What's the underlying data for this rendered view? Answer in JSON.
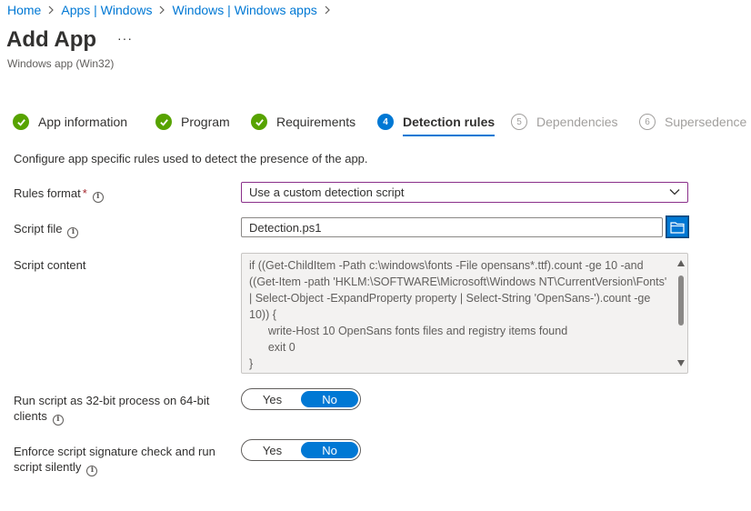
{
  "breadcrumb": [
    {
      "label": "Home"
    },
    {
      "label": "Apps | Windows"
    },
    {
      "label": "Windows | Windows apps"
    }
  ],
  "page": {
    "title": "Add App",
    "more_label": "···",
    "subtitle": "Windows app (Win32)"
  },
  "steps": [
    {
      "label": "App information",
      "state": "done",
      "icon": "checkmark-icon"
    },
    {
      "label": "Program",
      "state": "done",
      "icon": "checkmark-icon"
    },
    {
      "label": "Requirements",
      "state": "done",
      "icon": "checkmark-icon"
    },
    {
      "number": "4",
      "label": "Detection rules",
      "state": "active"
    },
    {
      "number": "5",
      "label": "Dependencies",
      "state": "pending"
    },
    {
      "number": "6",
      "label": "Supersedence",
      "state": "pending"
    }
  ],
  "description": "Configure app specific rules used to detect the presence of the app.",
  "form": {
    "rules_format": {
      "label": "Rules format",
      "required_marker": "*",
      "value": "Use a custom detection script"
    },
    "script_file": {
      "label": "Script file",
      "value": "Detection.ps1"
    },
    "script_content": {
      "label": "Script content",
      "value": "if ((Get-ChildItem -Path c:\\windows\\fonts -File opensans*.ttf).count -ge 10 -and ((Get-Item -path 'HKLM:\\SOFTWARE\\Microsoft\\Windows NT\\CurrentVersion\\Fonts' | Select-Object -ExpandProperty property | Select-String 'OpenSans-').count -ge 10)) {\n      write-Host 10 OpenSans fonts files and registry items found\n      exit 0\n}"
    },
    "run_32bit": {
      "label_line1": "Run script as 32-bit process on 64-bit",
      "label_line2": "clients",
      "yes": "Yes",
      "no": "No",
      "selected": "No"
    },
    "enforce_signature": {
      "label_line1": "Enforce script signature check and run",
      "label_line2": "script silently",
      "yes": "Yes",
      "no": "No",
      "selected": "No"
    }
  },
  "colors": {
    "accent": "#0078d4",
    "done": "#57a300",
    "dropdown_border": "#8a2f8a"
  }
}
